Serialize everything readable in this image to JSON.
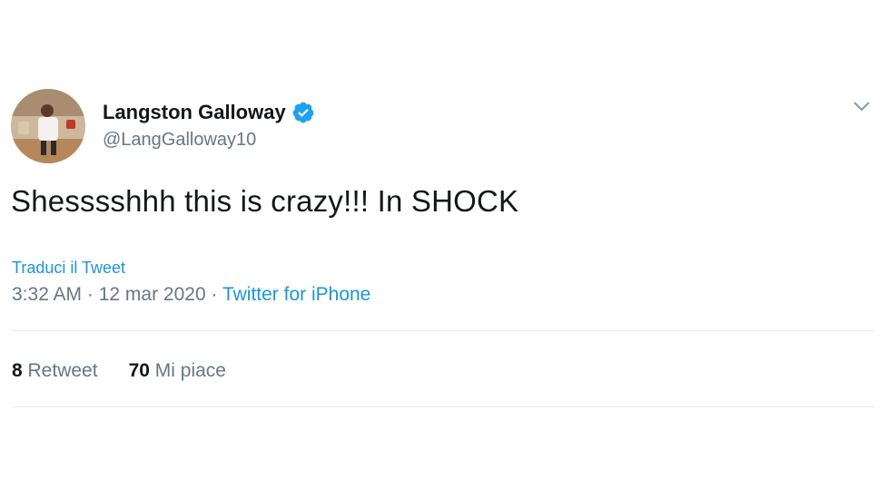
{
  "author": {
    "display_name": "Langston Galloway",
    "handle": "@LangGalloway10",
    "verified": true,
    "verified_icon": "verified-badge-icon",
    "avatar": "profile-avatar"
  },
  "menu_icon": "chevron-down-icon",
  "tweet": {
    "text": "Shesssshhh this is crazy!!! In SHOCK",
    "translate_label": "Traduci il Tweet",
    "time": "3:32 AM",
    "date": "12 mar 2020",
    "separator": "·",
    "source": "Twitter for iPhone"
  },
  "stats": {
    "retweets_count": "8",
    "retweets_label": "Retweet",
    "likes_count": "70",
    "likes_label": "Mi piace"
  },
  "colors": {
    "link": "#1b95e0",
    "secondary_text": "#657786",
    "primary_text": "#14171a",
    "verified": "#1da1f2"
  }
}
